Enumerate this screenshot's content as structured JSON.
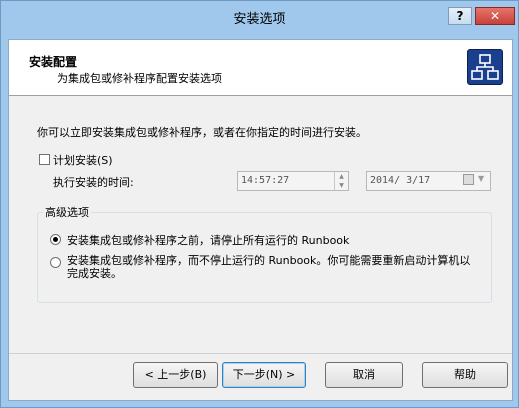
{
  "window": {
    "title": "安装选项"
  },
  "titlebar": {
    "help_glyph": "?",
    "close_glyph": "✕"
  },
  "header": {
    "title": "安装配置",
    "subtitle": "为集成包或修补程序配置安装选项"
  },
  "intro": "你可以立即安装集成包或修补程序，或者在你指定的时间进行安装。",
  "schedule": {
    "checkbox_label": "计划安装(S)",
    "checked": false,
    "time_label": "执行安装的时间:",
    "time_value": "14:57:27",
    "date_value": "2014/ 3/17"
  },
  "advanced": {
    "group_label": "高级选项",
    "option1": "安装集成包或修补程序之前，请停止所有运行的 Runbook",
    "option2": "安装集成包或修补程序，而不停止运行的 Runbook。你可能需要重新启动计算机以完成安装。",
    "selected": 1
  },
  "buttons": {
    "back": "< 上一步(B)",
    "next": "下一步(N) >",
    "cancel": "取消",
    "help": "帮助"
  },
  "icons": {
    "header": "network-hierarchy-icon",
    "spin_up": "▲",
    "spin_down": "▼",
    "dropdown": "▼"
  }
}
